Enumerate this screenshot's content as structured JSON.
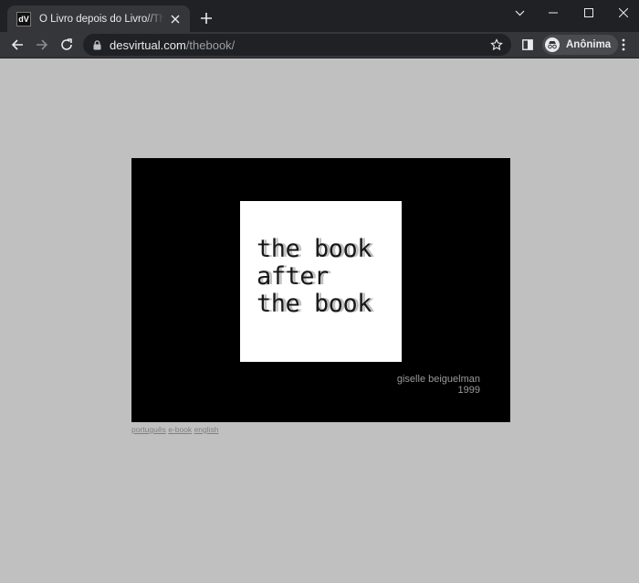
{
  "browser": {
    "tab_title": "O Livro depois do Livro//The Book after the Book",
    "favicon_text": "dV",
    "url_domain": "desvirtual.com",
    "url_path": "/thebook/",
    "profile_label": "Anônima",
    "icons": [
      "lock-icon",
      "star-icon",
      "sidebar-icon",
      "incognito-icon",
      "more-menu-icon"
    ]
  },
  "page": {
    "cover_lines": [
      "the book",
      "after",
      "the book"
    ],
    "author_name": "giselle beiguelman",
    "year": "1999",
    "lang_links": [
      "português",
      "e-book",
      "english"
    ]
  },
  "colors": {
    "page_background": "#c0c0c0",
    "stage_background": "#000000",
    "cover_background": "#ffffff",
    "author_text": "#9a9a9a"
  }
}
